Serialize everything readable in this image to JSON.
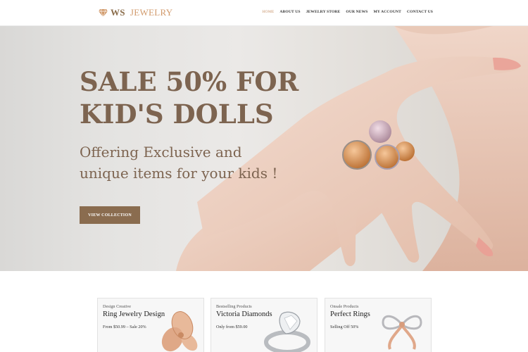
{
  "header": {
    "logo_ws": "WS",
    "logo_jewelry": "JEWELRY",
    "nav": [
      {
        "label": "HOME",
        "active": true
      },
      {
        "label": "ABOUT US",
        "active": false
      },
      {
        "label": "JEWELRY STORE",
        "active": false
      },
      {
        "label": "OUR NEWS",
        "active": false
      },
      {
        "label": "MY ACCOUNT",
        "active": false
      },
      {
        "label": "CONTACT US",
        "active": false
      }
    ]
  },
  "hero": {
    "title_line1": "SALE 50% FOR",
    "title_line2": "KID'S DOLLS",
    "subtitle_line1": "Offering Exclusive and",
    "subtitle_line2": "unique items for your kids !",
    "button_label": "VIEW COLLECTION"
  },
  "cards": [
    {
      "label": "Design Creative",
      "title": "Ring Jewelry Design",
      "price": "From $50.99 – Sale 20%"
    },
    {
      "label": "Bestselling Products",
      "title": "Victoria Diamonds",
      "price": "Only from $59.00"
    },
    {
      "label": "Onsale Products",
      "title": "Perfect Rings",
      "price": "Selling Off 50%"
    }
  ],
  "colors": {
    "brand_brown": "#7d6450",
    "button_brown": "#8a6c4f",
    "accent_copper": "#d19a6b",
    "nav_active": "#c8936a"
  }
}
